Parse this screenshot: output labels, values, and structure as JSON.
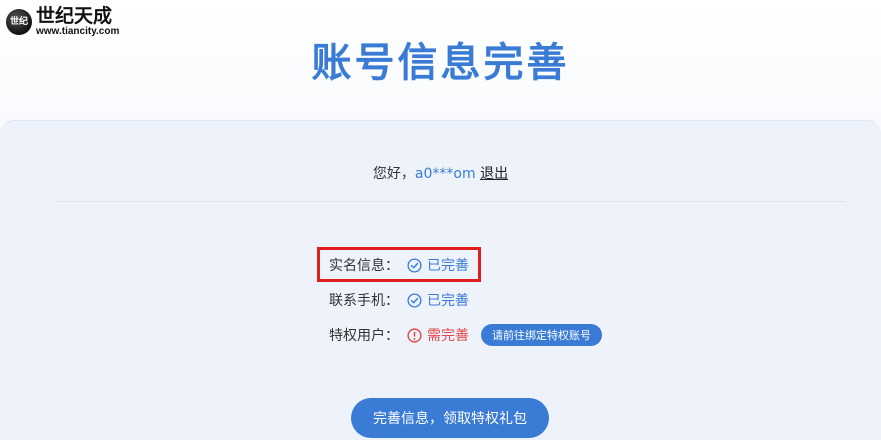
{
  "logo": {
    "mark": "世纪",
    "name": "世纪天成",
    "url": "www.tiancity.com"
  },
  "page_title": "账号信息完善",
  "greeting": {
    "prefix": "您好，",
    "username": "a0***om",
    "logout_label": "退出"
  },
  "rows": [
    {
      "label": "实名信息：",
      "status": "已完善",
      "icon": "check-circle-icon"
    },
    {
      "label": "联系手机：",
      "status": "已完善",
      "icon": "check-circle-icon"
    },
    {
      "label": "特权用户：",
      "status": "需完善",
      "icon": "alert-circle-icon",
      "action_label": "请前往绑定特权账号"
    }
  ],
  "submit_label": "完善信息，领取特权礼包",
  "colors": {
    "accent": "#3a7bd5",
    "warning": "#e04747",
    "highlight": "#e01e1e"
  }
}
